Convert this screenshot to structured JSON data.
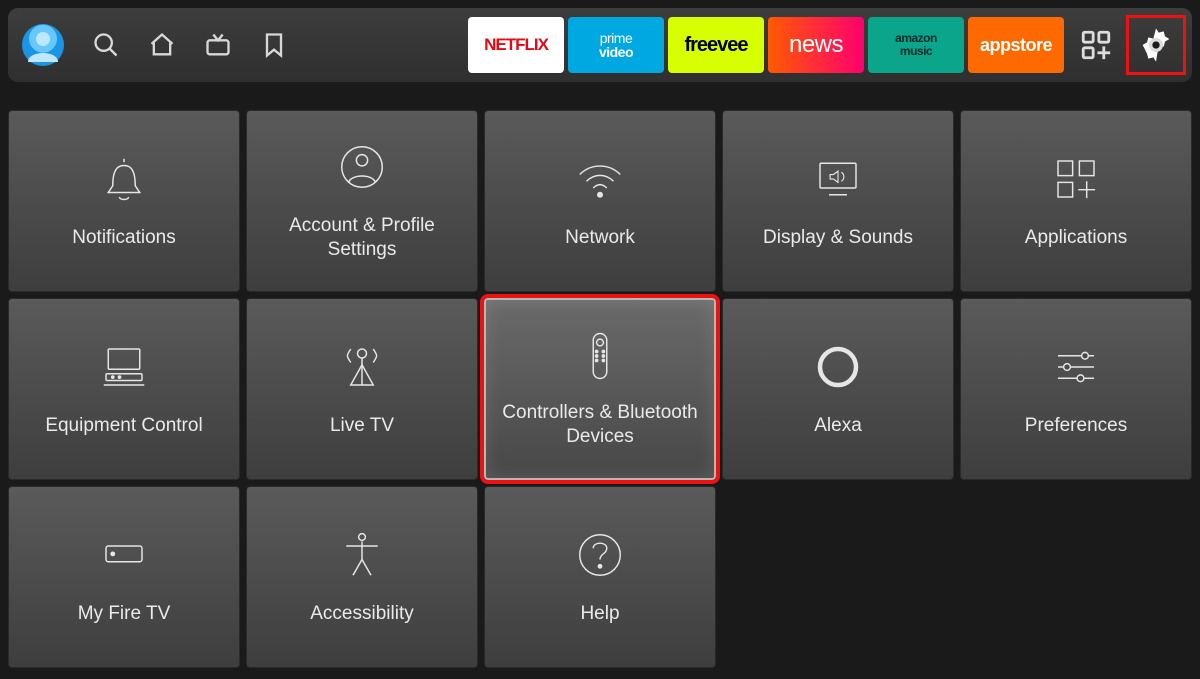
{
  "topbar": {
    "apps": {
      "netflix": "NETFLIX",
      "primevideo_line1": "prime",
      "primevideo_line2": "video",
      "freevee": "freevee",
      "news": "news",
      "music_line1": "amazon",
      "music_line2": "music",
      "appstore": "appstore"
    }
  },
  "settings": {
    "notifications": "Notifications",
    "account": "Account & Profile Settings",
    "network": "Network",
    "display": "Display & Sounds",
    "applications": "Applications",
    "equipment": "Equipment Control",
    "livetv": "Live TV",
    "controllers": "Controllers & Bluetooth Devices",
    "alexa": "Alexa",
    "preferences": "Preferences",
    "myfiretv": "My Fire TV",
    "accessibility": "Accessibility",
    "help": "Help"
  }
}
